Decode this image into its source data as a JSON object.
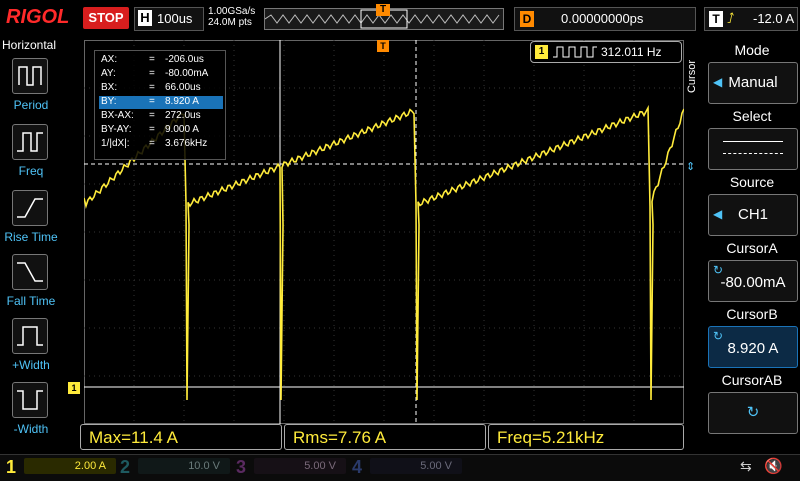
{
  "header": {
    "brand": "RIGOL",
    "run_state": "STOP",
    "h_label": "H",
    "timebase": "100us",
    "sample_rate": "1.00GSa/s",
    "memory_depth": "24.0M pts",
    "trig_marker": "T",
    "delay_label": "D",
    "delay_value": "0.00000000ps",
    "trig_label": "T",
    "trig_icon": "rising-edge-icon",
    "trig_level": "-12.0 A"
  },
  "left_menu": {
    "title": "Horizontal",
    "items": [
      {
        "label": "Period"
      },
      {
        "label": "Freq"
      },
      {
        "label": "Rise Time"
      },
      {
        "label": "Fall Time"
      },
      {
        "label": "+Width"
      },
      {
        "label": "-Width"
      }
    ]
  },
  "readout": {
    "rows": [
      {
        "key": "AX:",
        "eq": "=",
        "val": "-206.0us"
      },
      {
        "key": "AY:",
        "eq": "=",
        "val": "-80.00mA"
      },
      {
        "key": "BX:",
        "eq": "=",
        "val": "66.00us"
      },
      {
        "key": "BY:",
        "eq": "=",
        "val": "8.920 A"
      },
      {
        "key": "BX-AX:",
        "eq": "=",
        "val": "272.0us"
      },
      {
        "key": "BY-AY:",
        "eq": "=",
        "val": "9.000 A"
      },
      {
        "key": "1/|dX|:",
        "eq": "=",
        "val": "3.676kHz"
      }
    ]
  },
  "freq_counter": {
    "channel": "1",
    "value": "312.011 Hz"
  },
  "ground_marker": "1",
  "measurements": [
    {
      "text": "Max=11.4 A"
    },
    {
      "text": "Rms=7.76 A"
    },
    {
      "text": "Freq=5.21kHz"
    }
  ],
  "right_panel": {
    "side_label": "Cursor",
    "mode": {
      "title": "Mode",
      "value": "Manual"
    },
    "select": {
      "title": "Select"
    },
    "source": {
      "title": "Source",
      "value": "CH1"
    },
    "cursor_a": {
      "title": "CursorA",
      "value": "-80.00mA"
    },
    "cursor_b": {
      "title": "CursorB",
      "value": "8.920 A"
    },
    "cursor_ab": {
      "title": "CursorAB"
    }
  },
  "channels": [
    {
      "num": "1",
      "scale": "2.00 A",
      "color": "#ffeb3b",
      "active": true
    },
    {
      "num": "2",
      "scale": "10.0 V",
      "color": "#00bcd4",
      "active": false
    },
    {
      "num": "3",
      "scale": "5.00 V",
      "color": "#e040fb",
      "active": false
    },
    {
      "num": "4",
      "scale": "5.00 V",
      "color": "#3f7fff",
      "active": false
    }
  ],
  "colors": {
    "trace": "#ffeb3b",
    "accent": "#ff8a00",
    "stop": "#d81e1e",
    "select": "#1a73b8"
  },
  "waveform": {
    "period_us": 272,
    "low_level_a": -80,
    "peak_level_a": 11.4
  }
}
